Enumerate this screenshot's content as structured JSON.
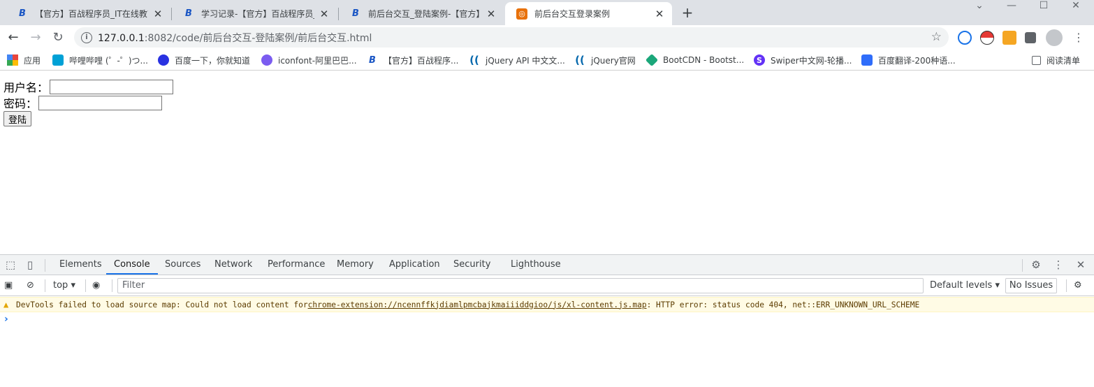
{
  "tabs": [
    {
      "favicon": "B",
      "title": "【官方】百战程序员_IT在线教育",
      "close": "✕"
    },
    {
      "favicon": "B",
      "title": "学习记录-【官方】百战程序员_IT",
      "close": "✕"
    },
    {
      "favicon": "B",
      "title": "前后台交互_登陆案例-【官方】百",
      "close": "✕"
    },
    {
      "favicon": "◎",
      "title": "前后台交互登录案例",
      "close": "✕",
      "active": true
    }
  ],
  "newtab": "+",
  "window": {
    "tabsearch": "⌄",
    "minimize": "—",
    "maximize": "☐",
    "close": "✕"
  },
  "toolbar": {
    "back": "←",
    "forward": "→",
    "reload": "↻",
    "url_host": "127.0.0.1",
    "url_rest": ":8082/code/前后台交互-登陆案例/前后台交互.html",
    "info": "i",
    "star": "☆"
  },
  "bookmarks": [
    {
      "icon": "apps-icon",
      "label": "应用",
      "color": "#e8453c"
    },
    {
      "icon": "bilibili-icon",
      "label": "哔哩哔哩 (゜-゜)つ...",
      "color": "#00a1d6"
    },
    {
      "icon": "baidu-icon",
      "label": "百度一下，你就知道",
      "color": "#2932e1"
    },
    {
      "icon": "iconfont-icon",
      "label": "iconfont-阿里巴巴...",
      "color": "#7b5cf0"
    },
    {
      "icon": "baizhan-icon",
      "label": "【官方】百战程序...",
      "color": "#1a56c4"
    },
    {
      "icon": "jquery-icon",
      "label": "jQuery API 中文文...",
      "color": "#0769ad"
    },
    {
      "icon": "jquery-icon",
      "label": "jQuery官网",
      "color": "#0769ad"
    },
    {
      "icon": "bootcdn-icon",
      "label": "BootCDN - Bootst...",
      "color": "#1ba77a"
    },
    {
      "icon": "swiper-icon",
      "label": "Swiper中文网-轮播...",
      "color": "#6332f6"
    },
    {
      "icon": "fanyi-icon",
      "label": "百度翻译-200种语...",
      "color": "#2f6dfa"
    }
  ],
  "reading_list": "阅读清单",
  "page": {
    "username_label": "用户名：",
    "password_label": "密码：",
    "login_button": "登陆"
  },
  "devtools": {
    "tabs": [
      "Elements",
      "Console",
      "Sources",
      "Network",
      "Performance",
      "Memory",
      "Application",
      "Security",
      "Lighthouse"
    ],
    "active_tab": "Console",
    "context": "top",
    "filter_placeholder": "Filter",
    "default_levels": "Default levels",
    "no_issues": "No Issues",
    "warning_prefix": "DevTools failed to load source map: Could not load content for ",
    "warning_link": "chrome-extension://ncennffkjdiamlpmcbajkmaiiiddgioo/js/xl-content.js.map",
    "warning_suffix": ": HTTP error: status code 404, net::ERR_UNKNOWN_URL_SCHEME",
    "prompt": "›"
  }
}
